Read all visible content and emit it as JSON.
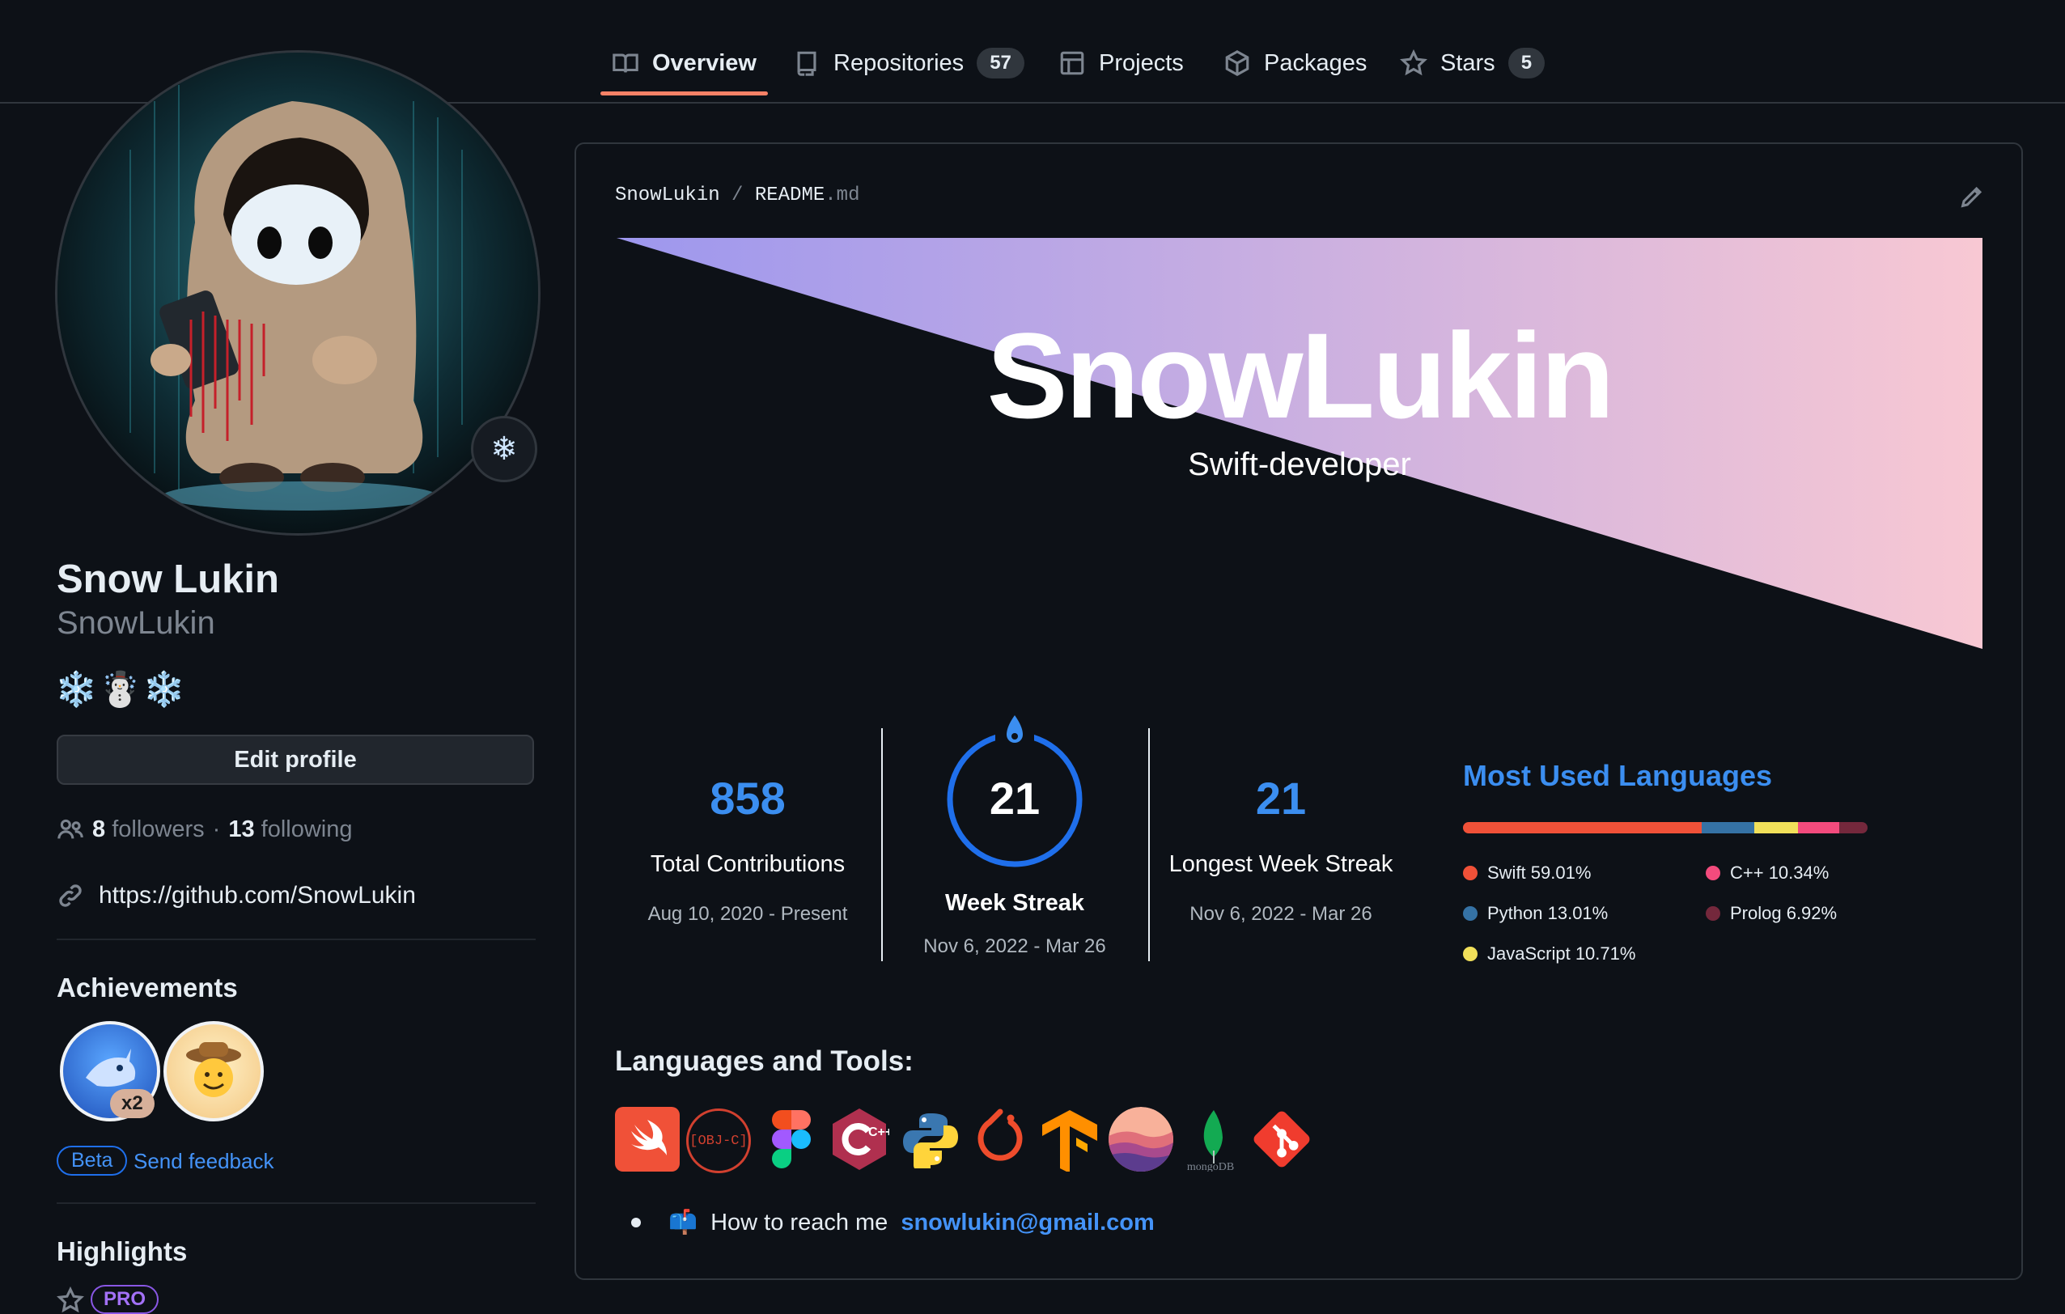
{
  "nav": {
    "tabs": [
      {
        "label": "Overview",
        "icon": "book-icon"
      },
      {
        "label": "Repositories",
        "count": "57",
        "icon": "repo-icon"
      },
      {
        "label": "Projects",
        "icon": "table-icon"
      },
      {
        "label": "Packages",
        "icon": "package-icon"
      },
      {
        "label": "Stars",
        "count": "5",
        "icon": "star-icon"
      }
    ],
    "active_tab": "Overview"
  },
  "profile": {
    "full_name": "Snow Lukin",
    "login": "SnowLukin",
    "bio": "❄️☃️❄️",
    "status_emoji": "❄",
    "edit_button": "Edit profile",
    "followers_count": "8",
    "followers_label": "followers",
    "separator": "·",
    "following_count": "13",
    "following_label": "following",
    "website": "https://github.com/SnowLukin"
  },
  "achievements": {
    "title": "Achievements",
    "multiplier": "x2",
    "beta_label": "Beta",
    "feedback_label": "Send feedback"
  },
  "highlights": {
    "title": "Highlights",
    "pro_label": "PRO"
  },
  "readme": {
    "owner": "SnowLukin",
    "slash": "/",
    "file": "README",
    "ext": ".md",
    "banner_title": "SnowLukin",
    "banner_subtitle": "Swift-developer",
    "stats": {
      "total_contributions": "858",
      "total_label": "Total Contributions",
      "total_range": "Aug 10, 2020 - Present",
      "current_streak": "21",
      "current_label": "Week Streak",
      "current_range": "Nov 6, 2022 - Mar 26",
      "longest_streak": "21",
      "longest_label": "Longest Week Streak",
      "longest_range": "Nov 6, 2022 - Mar 26"
    },
    "languages": {
      "title": "Most Used Languages",
      "items": [
        {
          "name": "Swift",
          "percent": "59.01%",
          "value": 59.01,
          "color": "#F05138"
        },
        {
          "name": "Python",
          "percent": "13.01%",
          "value": 13.01,
          "color": "#3572A5"
        },
        {
          "name": "JavaScript",
          "percent": "10.71%",
          "value": 10.71,
          "color": "#F1E05A"
        },
        {
          "name": "C++",
          "percent": "10.34%",
          "value": 10.34,
          "color": "#F34B7D"
        },
        {
          "name": "Prolog",
          "percent": "6.92%",
          "value": 6.92,
          "color": "#74283C"
        }
      ]
    },
    "tools_title": "Languages and Tools:",
    "tools": [
      "swift-icon",
      "objc-icon",
      "figma-icon",
      "cplusplus-icon",
      "python-icon",
      "pytorch-icon",
      "tensorflow-icon",
      "seaborn-icon",
      "mongodb-icon",
      "git-icon"
    ],
    "tool_texts": {
      "objc": "[OBJ-C]",
      "mongodb": "mongoDB",
      "cpp": "C++"
    },
    "reach_emoji": "📫",
    "reach_text": "How to reach me",
    "reach_email": "snowlukin@gmail.com"
  },
  "colors": {
    "accent_blue": "#3b8ef0",
    "link_blue": "#4493f8",
    "tab_underline": "#f78166",
    "banner_gradient_start": "#9d97ee",
    "banner_gradient_end": "#f8c8d3"
  }
}
